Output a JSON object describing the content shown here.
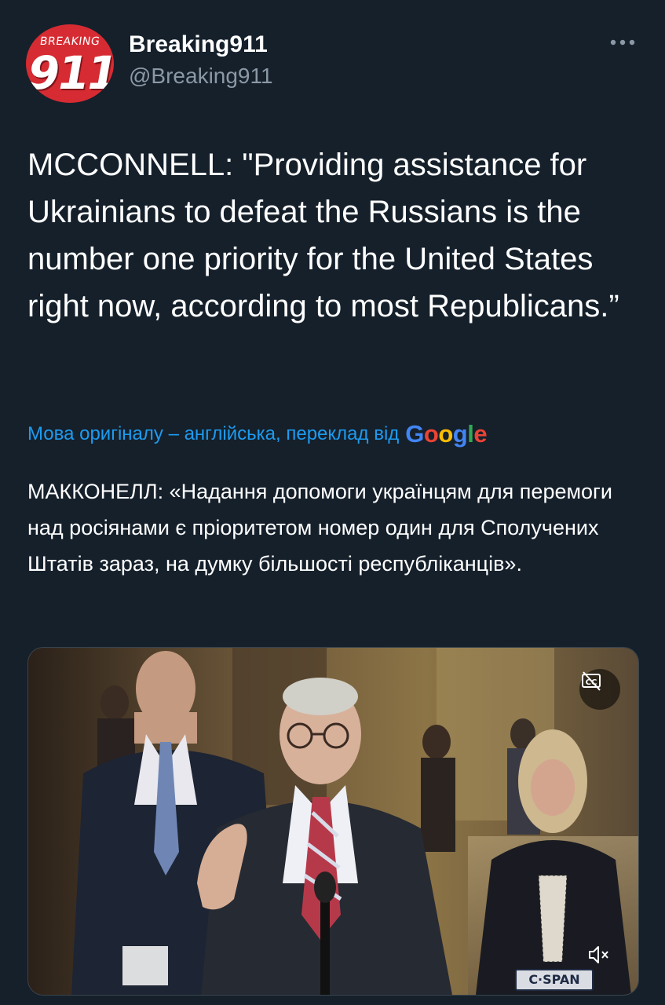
{
  "author": {
    "avatar_top_text": "BREAKING",
    "avatar_number": "911",
    "display_name": "Breaking911",
    "handle": "@Breaking911"
  },
  "actions": {
    "more_icon": "more-horizontal-icon"
  },
  "tweet": {
    "text": "MCCONNELL: \"Providing assistance for Ukrainians to defeat the Russians is the number one priority for the United States right now, according to most Republicans.”"
  },
  "translation": {
    "label": "Мова оригіналу – англійська, переклад від",
    "provider": "Google",
    "provider_colors": [
      "#4285f4",
      "#ea4335",
      "#fbbc05",
      "#4285f4",
      "#34a853",
      "#ea4335"
    ],
    "text": "МАККОНЕЛЛ: «Надання допомоги українцям для перемоги над росіянами є пріоритетом номер один для Сполучених Штатів зараз, на думку більшості республіканців»."
  },
  "media": {
    "type": "video",
    "captions_icon": "closed-captions-off-icon",
    "mute_icon": "volume-muted-icon",
    "broadcaster_logo": "C·SPAN"
  },
  "colors": {
    "background": "#15202b",
    "text_primary": "#ffffff",
    "text_secondary": "#8b98a5",
    "link": "#1d9bf0",
    "avatar_red": "#d62b32"
  }
}
